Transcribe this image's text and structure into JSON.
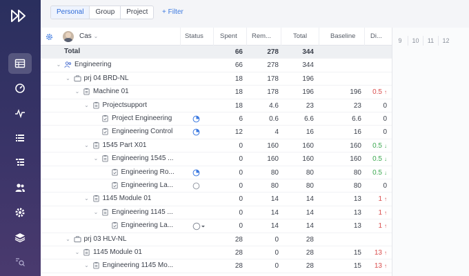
{
  "segments": [
    "Personal",
    "Group",
    "Project"
  ],
  "filter_label": "+ Filter",
  "header": {
    "user": "Cas",
    "status": "Status",
    "spent": "Spent",
    "remaining": "Rem...",
    "total": "Total",
    "baseline": "Baseline",
    "diff": "Di..."
  },
  "timeline_days": [
    "9",
    "10",
    "11",
    "12"
  ],
  "rows": [
    {
      "name": "Total",
      "spent": "66",
      "rem": "278",
      "total": "344",
      "baseline": "",
      "diff": ""
    },
    {
      "name": "Engineering",
      "spent": "66",
      "rem": "278",
      "total": "344",
      "baseline": "",
      "diff": ""
    },
    {
      "name": "prj 04 BRD-NL",
      "spent": "18",
      "rem": "178",
      "total": "196",
      "baseline": "",
      "diff": ""
    },
    {
      "name": "Machine 01",
      "spent": "18",
      "rem": "178",
      "total": "196",
      "baseline": "196",
      "diff": "0.5"
    },
    {
      "name": "Projectsupport",
      "spent": "18",
      "rem": "4.6",
      "total": "23",
      "baseline": "23",
      "diff": "0"
    },
    {
      "name": "Project Engineering",
      "spent": "6",
      "rem": "0.6",
      "total": "6.6",
      "baseline": "6.6",
      "diff": "0"
    },
    {
      "name": "Engineering Control",
      "spent": "12",
      "rem": "4",
      "total": "16",
      "baseline": "16",
      "diff": "0"
    },
    {
      "name": "1545 Part X01",
      "spent": "0",
      "rem": "160",
      "total": "160",
      "baseline": "160",
      "diff": "0.5"
    },
    {
      "name": "Engineering 1545 ...",
      "spent": "0",
      "rem": "160",
      "total": "160",
      "baseline": "160",
      "diff": "0.5"
    },
    {
      "name": "Engineering Ro...",
      "spent": "0",
      "rem": "80",
      "total": "80",
      "baseline": "80",
      "diff": "0.5"
    },
    {
      "name": "Engineering La...",
      "spent": "0",
      "rem": "80",
      "total": "80",
      "baseline": "80",
      "diff": "0"
    },
    {
      "name": "1145 Module 01",
      "spent": "0",
      "rem": "14",
      "total": "14",
      "baseline": "13",
      "diff": "1"
    },
    {
      "name": "Engineering 1145 ...",
      "spent": "0",
      "rem": "14",
      "total": "14",
      "baseline": "13",
      "diff": "1"
    },
    {
      "name": "Engineering La...",
      "spent": "0",
      "rem": "14",
      "total": "14",
      "baseline": "13",
      "diff": "1"
    },
    {
      "name": "prj 03 HLV-NL",
      "spent": "28",
      "rem": "0",
      "total": "28",
      "baseline": "",
      "diff": ""
    },
    {
      "name": "1145 Module 01",
      "spent": "28",
      "rem": "0",
      "total": "28",
      "baseline": "15",
      "diff": "13"
    },
    {
      "name": "Engineering 1145 Mo...",
      "spent": "28",
      "rem": "0",
      "total": "28",
      "baseline": "15",
      "diff": "13"
    }
  ],
  "colors": {
    "accent": "#3d7ae0",
    "up": "#d94b4b",
    "down": "#3aa74f"
  }
}
